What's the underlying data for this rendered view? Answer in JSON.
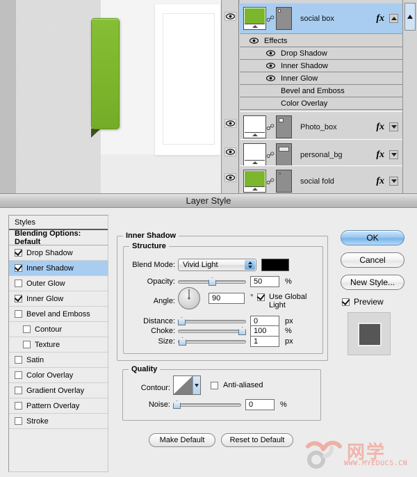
{
  "canvas": {
    "green_tab_color": "#7cb62d",
    "fold_color": "#3f5423",
    "frame_color": "#ffffff"
  },
  "layers_panel": {
    "layers": [
      {
        "name": "social box",
        "thumb_color": "#7cb62d",
        "selected": true,
        "has_fx": true,
        "visible": true,
        "fx_expanded": true,
        "triangle": "up",
        "effects_group_label": "Effects",
        "effects": [
          {
            "label": "Drop Shadow",
            "visible": true
          },
          {
            "label": "Inner Shadow",
            "visible": true
          },
          {
            "label": "Inner Glow",
            "visible": true
          },
          {
            "label": "Bevel and Emboss",
            "visible": false
          },
          {
            "label": "Color Overlay",
            "visible": false
          }
        ]
      },
      {
        "name": "Photo_box",
        "thumb_color": "#ffffff",
        "selected": false,
        "has_fx": true,
        "visible": true,
        "triangle": "down"
      },
      {
        "name": "personal_bg",
        "thumb_color": "#ffffff",
        "selected": false,
        "has_fx": true,
        "visible": true,
        "triangle": "down"
      },
      {
        "name": "social fold",
        "thumb_color": "#7cb62d",
        "selected": false,
        "has_fx": true,
        "visible": true,
        "triangle": "down"
      }
    ],
    "fx_glyph": "fx"
  },
  "dialog": {
    "title": "Layer Style",
    "styles_list": {
      "header": "Styles",
      "blending_options": "Blending Options: Default",
      "items": [
        {
          "label": "Drop Shadow",
          "checked": true,
          "indent": false,
          "active": false
        },
        {
          "label": "Inner Shadow",
          "checked": true,
          "indent": false,
          "active": true
        },
        {
          "label": "Outer Glow",
          "checked": false,
          "indent": false,
          "active": false
        },
        {
          "label": "Inner Glow",
          "checked": true,
          "indent": false,
          "active": false
        },
        {
          "label": "Bevel and Emboss",
          "checked": false,
          "indent": false,
          "active": false
        },
        {
          "label": "Contour",
          "checked": false,
          "indent": true,
          "active": false
        },
        {
          "label": "Texture",
          "checked": false,
          "indent": true,
          "active": false
        },
        {
          "label": "Satin",
          "checked": false,
          "indent": false,
          "active": false
        },
        {
          "label": "Color Overlay",
          "checked": false,
          "indent": false,
          "active": false
        },
        {
          "label": "Gradient Overlay",
          "checked": false,
          "indent": false,
          "active": false
        },
        {
          "label": "Pattern Overlay",
          "checked": false,
          "indent": false,
          "active": false
        },
        {
          "label": "Stroke",
          "checked": false,
          "indent": false,
          "active": false
        }
      ]
    },
    "panel": {
      "title": "Inner Shadow",
      "structure": {
        "legend": "Structure",
        "blend_mode_label": "Blend Mode:",
        "blend_mode_value": "Vivid Light",
        "blend_color": "#000000",
        "opacity_label": "Opacity:",
        "opacity_value": "50",
        "opacity_unit": "%",
        "opacity_pct": 50,
        "angle_label": "Angle:",
        "angle_value": "90",
        "angle_unit": "°",
        "use_global_light": "Use Global Light",
        "use_global_light_checked": true,
        "distance_label": "Distance:",
        "distance_value": "0",
        "distance_unit": "px",
        "distance_pct": 0,
        "choke_label": "Choke:",
        "choke_value": "100",
        "choke_unit": "%",
        "choke_pct": 100,
        "size_label": "Size:",
        "size_value": "1",
        "size_unit": "px",
        "size_pct": 1
      },
      "quality": {
        "legend": "Quality",
        "contour_label": "Contour:",
        "anti_aliased_label": "Anti-aliased",
        "anti_aliased_checked": false,
        "noise_label": "Noise:",
        "noise_value": "0",
        "noise_unit": "%",
        "noise_pct": 0
      },
      "make_default": "Make Default",
      "reset_to_default": "Reset to Default"
    },
    "buttons": {
      "ok": "OK",
      "cancel": "Cancel",
      "new_style": "New Style...",
      "preview": "Preview",
      "preview_checked": true
    }
  },
  "watermark": {
    "logo_text": "网学",
    "url": "WWW.MYEDUCS.CN",
    "color": "#f0b0a6"
  }
}
